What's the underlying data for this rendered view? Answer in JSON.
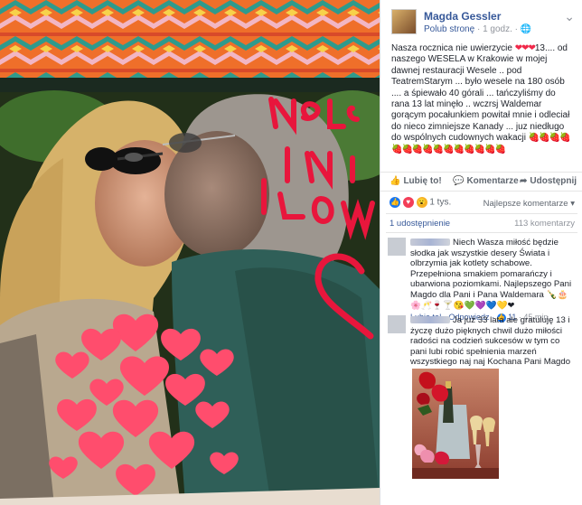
{
  "post": {
    "author": "Magda Gessler",
    "follow_link": "Polub stronę",
    "dot": "·",
    "time": "1 godz.",
    "separator": "·",
    "more_glyph": "⌄",
    "text_part1": "Nasza rocznica nie uwierzycie ",
    "hearts": "❤❤❤",
    "text_part2": "13.... od naszego WESELA w Krakowie w mojej dawnej restauracji Wesele .. pod TeatremStarym ... było wesele na 180 osób .... a śpiewało 40 górali ... tańczyliśmy do rana 13 lat minęło .. wczrsj Waldemar gorącym pocałunkiem powitał mnie i odleciał do nieco zimniejsze Kanady ... juz niedługo do wspólnych cudownych wakacji ",
    "strawberries": "🍓🍓🍓🍓🍓🍓🍓🍓🍓🍓🍓🍓🍓🍓🍓"
  },
  "actions": {
    "like": "Lubię to!",
    "comment": "Komentarze",
    "share": "Udostępnij",
    "like_icon": "thumbs-up-icon",
    "comment_icon": "speech-bubble-icon",
    "share_icon": "share-arrow-icon"
  },
  "reactions": {
    "count": "1 tys.",
    "like_glyph": "👍",
    "love_glyph": "♥",
    "wow_glyph": "😮"
  },
  "sort": {
    "label": "Najlepsze komentarze",
    "arrow": "▾"
  },
  "shares": {
    "label": "1 udostępnienie"
  },
  "comments_count": {
    "label": "113 komentarzy"
  },
  "comments": [
    {
      "text": "Niech Wasza miłość będzie słodka jak wszystkie desery Świata i olbrzymia jak kotlety schabowe. Przepełniona smakiem pomarańczy i ubarwiona poziomkami. Najlepszego Pani Magdo dla Pani i Pana Waldemara 🍾🎂🌸🥂🍷🍸😘💚💜💙💛❤",
      "like": "Lubię to!",
      "sep1": " · ",
      "reply": "Odpowiedz",
      "sep2": " · ",
      "likes": "11",
      "sep3": " · ",
      "time": "45 min"
    },
    {
      "text": "Ja już 33 lata ale gratuluję 13 i życzę dużo pięknych chwil dużo miłości radości na codzień sukcesów w tym co pani lubi robić spełnienia marzeń wszystkiego naj naj Kochana Pani Magdo"
    }
  ],
  "colors": {
    "link": "#365899",
    "secondary": "#90949c",
    "text": "#1d2129",
    "love": "#f33e58",
    "like": "#1877f2"
  }
}
